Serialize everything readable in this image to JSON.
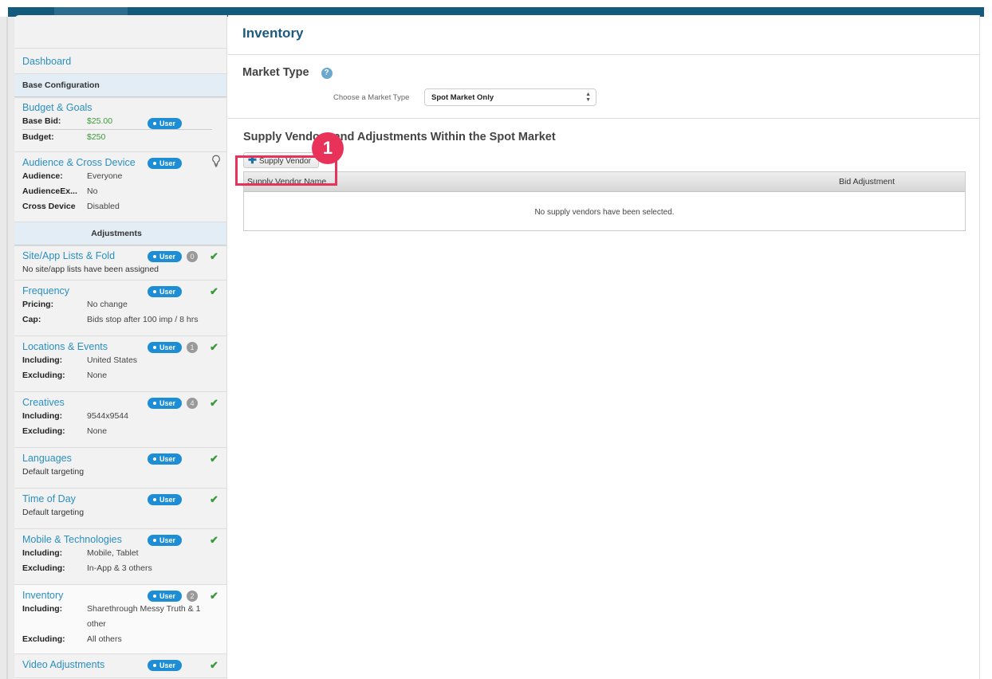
{
  "sidebar": {
    "dashboard": "Dashboard",
    "base_configuration": "Base Configuration",
    "adjustments": "Adjustments",
    "user_badge": "User",
    "items": {
      "budget": {
        "title": "Budget & Goals",
        "rows": [
          {
            "k": "Base Bid:",
            "v": "$25.00"
          },
          {
            "k": "Budget:",
            "v": "$250"
          }
        ]
      },
      "audience": {
        "title": "Audience & Cross Device",
        "rows": [
          {
            "k": "Audience:",
            "v": "Everyone"
          },
          {
            "k": "AudienceEx...",
            "v": "No"
          },
          {
            "k": "Cross Device",
            "v": "Disabled"
          }
        ]
      },
      "siteapp": {
        "title": "Site/App Lists & Fold",
        "count": "0",
        "note": "No site/app lists have been assigned"
      },
      "frequency": {
        "title": "Frequency",
        "rows": [
          {
            "k": "Pricing:",
            "v": "No change"
          },
          {
            "k": "Cap:",
            "v": "Bids stop after 100 imp / 8 hrs"
          }
        ]
      },
      "locations": {
        "title": "Locations & Events",
        "count": "1",
        "rows": [
          {
            "k": "Including:",
            "v": "United States"
          },
          {
            "k": "Excluding:",
            "v": "None"
          }
        ]
      },
      "creatives": {
        "title": "Creatives",
        "count": "4",
        "rows": [
          {
            "k": "Including:",
            "v": "9544x9544"
          },
          {
            "k": "Excluding:",
            "v": "None"
          }
        ]
      },
      "languages": {
        "title": "Languages",
        "note": "Default targeting"
      },
      "timeofday": {
        "title": "Time of Day",
        "note": "Default targeting"
      },
      "mobile": {
        "title": "Mobile & Technologies",
        "rows": [
          {
            "k": "Including:",
            "v": "Mobile, Tablet"
          },
          {
            "k": "Excluding:",
            "v": "In-App & 3 others"
          }
        ]
      },
      "inventory": {
        "title": "Inventory",
        "count": "2",
        "rows": [
          {
            "k": "Including:",
            "v": "Sharethrough Messy Truth & 1 other"
          },
          {
            "k": "Excluding:",
            "v": "All others"
          }
        ]
      },
      "video": {
        "title": "Video Adjustments"
      }
    }
  },
  "main": {
    "title": "Inventory",
    "market_type": {
      "heading": "Market Type",
      "help_icon": "?",
      "label": "Choose a Market Type",
      "selected": "Spot Market Only"
    },
    "vendors": {
      "heading": "Supply Vendors and Adjustments Within the Spot Market",
      "add_button": "Supply Vendor",
      "columns": [
        "Supply Vendor Name",
        "Bid Adjustment"
      ],
      "empty_message": "No supply vendors have been selected."
    }
  },
  "annotation": {
    "number": "1",
    "color": "#e8325a"
  },
  "colors": {
    "topbar": "#135a7c",
    "link": "#2a8fc0",
    "user_badge": "#1d8ed6",
    "check": "#3a9a3a",
    "title": "#1d5a80"
  }
}
